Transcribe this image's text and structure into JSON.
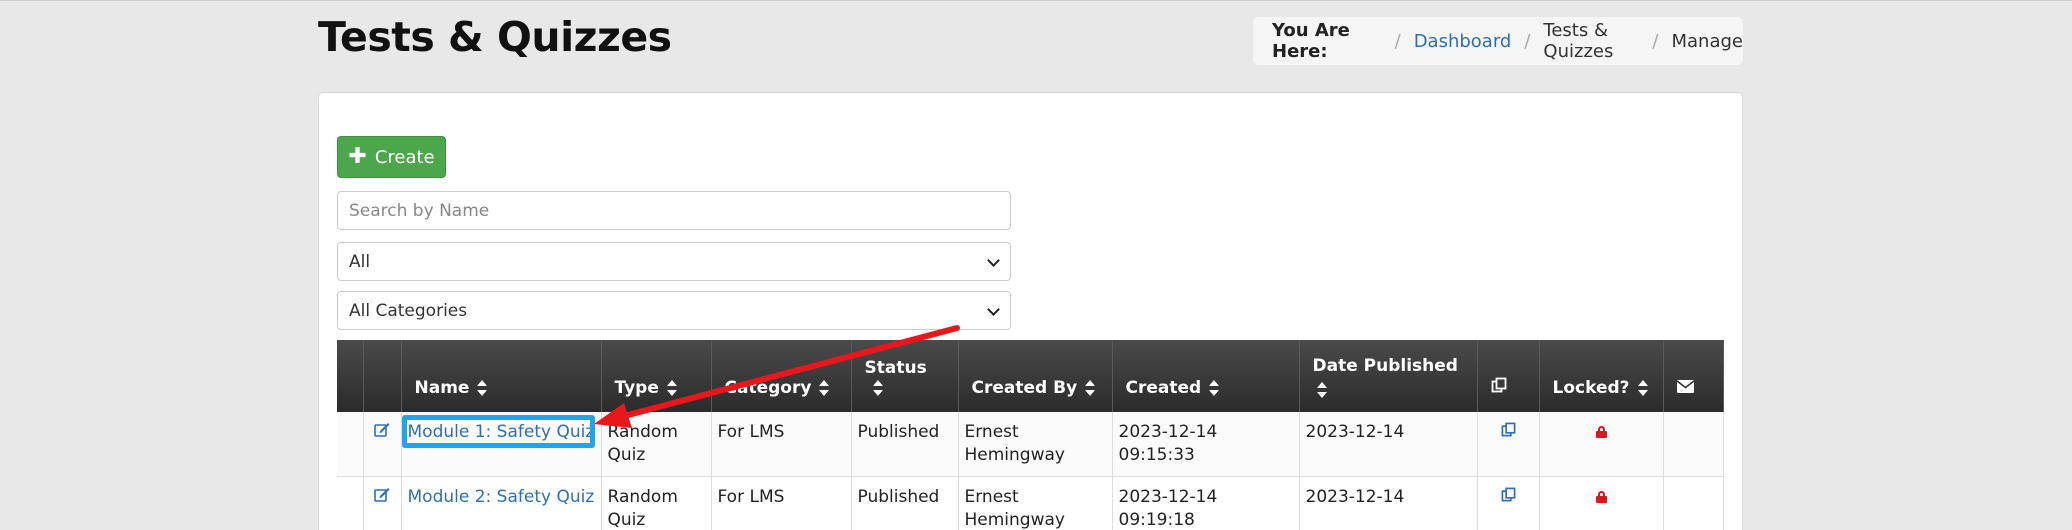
{
  "page": {
    "title": "Tests & Quizzes"
  },
  "breadcrumb": {
    "lead": "You Are Here:",
    "items": [
      "Dashboard",
      "Tests & Quizzes",
      "Manage"
    ]
  },
  "toolbar": {
    "create_label": "Create"
  },
  "filters": {
    "search_placeholder": "Search by Name",
    "status_selected": "All",
    "category_selected": "All Categories"
  },
  "table": {
    "headers": [
      "",
      "",
      "Name",
      "Type",
      "Category",
      "Status",
      "Created By",
      "Created",
      "Date Published",
      "",
      "Locked?",
      ""
    ],
    "rows": [
      {
        "name": "Module 1: Safety Quiz",
        "type": "Random Quiz",
        "category": "For LMS",
        "status": "Published",
        "created_by": "Ernest Hemingway",
        "created": "2023-12-14 09:15:33",
        "date_published": "2023-12-14",
        "locked": true
      },
      {
        "name": "Module 2: Safety Quiz",
        "type": "Random Quiz",
        "category": "For LMS",
        "status": "Published",
        "created_by": "Ernest Hemingway",
        "created": "2023-12-14 09:19:18",
        "date_published": "2023-12-14",
        "locked": true
      }
    ]
  },
  "colors": {
    "create_button": "#4ca64c",
    "link": "#2f6fb0",
    "highlight": "#1aa6f0",
    "annotation_arrow": "#e8171c",
    "lock": "#e0141c"
  }
}
